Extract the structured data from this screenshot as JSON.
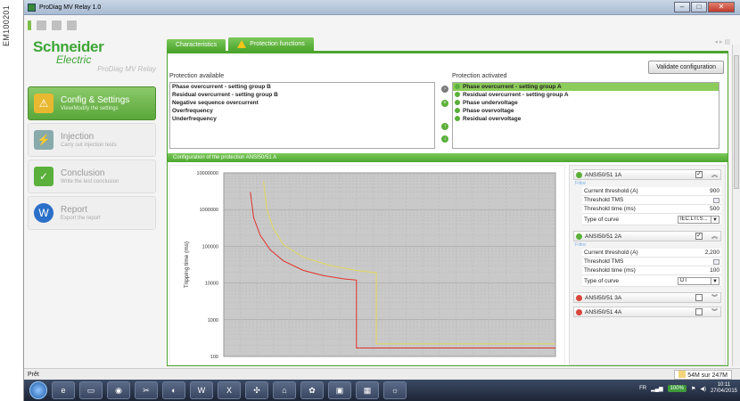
{
  "margin_label": "EM100201",
  "window": {
    "title": "ProDiag MV Relay 1.0",
    "buttons": [
      "–",
      "□",
      "✕"
    ]
  },
  "brand": {
    "name": "Schneider",
    "sub": "Electric",
    "product": "ProDiag MV Relay"
  },
  "sidebar": {
    "items": [
      {
        "label": "Config & Settings",
        "sub": "View/Modify the settings",
        "icon": "warning-icon",
        "active": true
      },
      {
        "label": "Injection",
        "sub": "Carry out injection tests",
        "icon": "plug-icon",
        "active": false
      },
      {
        "label": "Conclusion",
        "sub": "Write the test conclusion",
        "icon": "checkmark-icon",
        "active": false
      },
      {
        "label": "Report",
        "sub": "Export the report",
        "icon": "word-icon",
        "active": false
      }
    ]
  },
  "tabs": [
    {
      "label": "Characteristics"
    },
    {
      "label": "Protection functions"
    }
  ],
  "validate_label": "Validate configuration",
  "available": {
    "heading": "Protection available",
    "items": [
      "Phase overcurrent - setting group B",
      "Residual overcurrent - setting group B",
      "Negative sequence overcurrent",
      "Overfrequency",
      "Underfrequency"
    ]
  },
  "activated": {
    "heading": "Protection activated",
    "items": [
      "Phase overcurrent - setting group A",
      "Residual overcurrent - setting group A",
      "Phase undervoltage",
      "Phase overvoltage",
      "Residual overvoltage"
    ]
  },
  "config_title": "Configuration of the protection ANSI50/51 A",
  "curves_panel": {
    "filter_label": "Filtre",
    "items": [
      {
        "name": "ANSI50/51 1A",
        "status": "on",
        "checked": true,
        "params": {
          "current_threshold_label": "Current threshold (A)",
          "current_threshold": "900",
          "tms_label": "Threshold TMS",
          "time_label": "Threshold time (ms)",
          "time": "500",
          "curve_label": "Type of curve",
          "curve": "IEC.LTI.S..."
        }
      },
      {
        "name": "ANSI50/51 2A",
        "status": "on",
        "checked": true,
        "params": {
          "current_threshold_label": "Current threshold (A)",
          "current_threshold": "2,200",
          "tms_label": "Threshold TMS",
          "time_label": "Threshold time (ms)",
          "time": "100",
          "curve_label": "Type of curve",
          "curve": "DT"
        }
      },
      {
        "name": "ANSI50/51 3A",
        "status": "off",
        "checked": false
      },
      {
        "name": "ANSI50/51 4A",
        "status": "off",
        "checked": false
      }
    ]
  },
  "status": {
    "text": "Prêt",
    "memory": "54M sur 247M"
  },
  "taskbar": {
    "lang": "FR",
    "battery": "100%",
    "time": "10:11",
    "date": "27/04/2015"
  },
  "chart_data": {
    "type": "line",
    "title": "",
    "xlabel": "",
    "ylabel": "Tripping time (ms)",
    "yscale": "log",
    "y_ticks": [
      "10000000",
      "1000000",
      "100000",
      "10000",
      "1000",
      "100"
    ],
    "ylim": [
      100,
      10000000
    ],
    "xlim": [
      0,
      100
    ],
    "grid": true,
    "series": [
      {
        "color": "#e0312a",
        "points": [
          [
            8,
            3000000
          ],
          [
            9,
            600000
          ],
          [
            11,
            200000
          ],
          [
            14,
            80000
          ],
          [
            18,
            40000
          ],
          [
            24,
            22000
          ],
          [
            30,
            16000
          ],
          [
            36,
            13000
          ],
          [
            40,
            12000
          ],
          [
            40,
            170
          ],
          [
            100,
            170
          ]
        ]
      },
      {
        "color": "#e2d75a",
        "points": [
          [
            12,
            6000000
          ],
          [
            13,
            1000000
          ],
          [
            15,
            300000
          ],
          [
            18,
            110000
          ],
          [
            24,
            50000
          ],
          [
            32,
            30000
          ],
          [
            40,
            22000
          ],
          [
            46,
            19000
          ],
          [
            46,
            220
          ],
          [
            100,
            220
          ]
        ]
      }
    ]
  }
}
